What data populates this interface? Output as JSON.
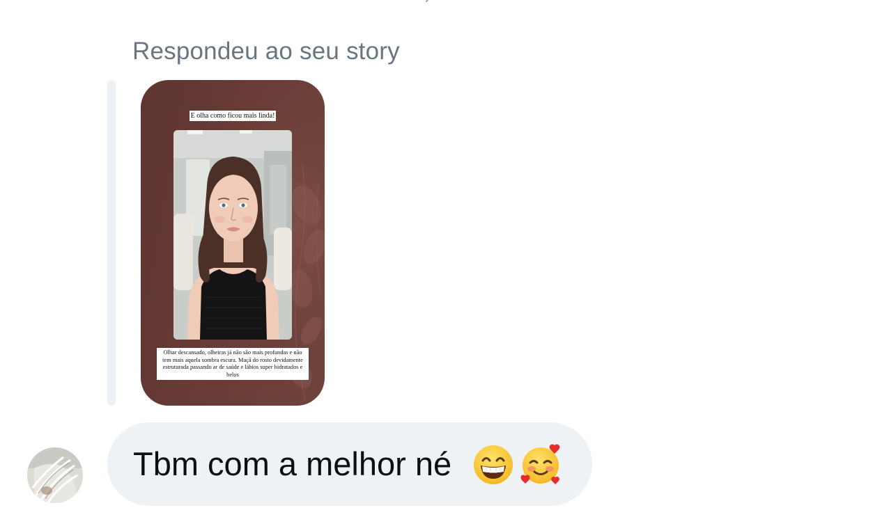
{
  "story_reply": {
    "label": "Respondeu ao seu story",
    "story": {
      "caption_top": "E olha como ficou mais linda!",
      "caption_bottom": "Olhar descansado, olheiras já não são mais profundas e não tem mais aquela sombra escura. Maçã do rosto devidamente estruturada passando ar de saúde e lábios super hidratados e belos",
      "background_color": "#6a3c37"
    }
  },
  "message": {
    "text": "Tbm com a melhor né",
    "emojis": [
      "grinning-face-with-smiling-eyes-emoji",
      "smiling-face-with-hearts-emoji"
    ],
    "bubble_color": "#eff2f4"
  },
  "sender": {
    "avatar_icon": "avatar"
  },
  "colors": {
    "label_text": "#6b7480",
    "message_text": "#0b0f14",
    "reply_bar": "#eef1f3"
  }
}
